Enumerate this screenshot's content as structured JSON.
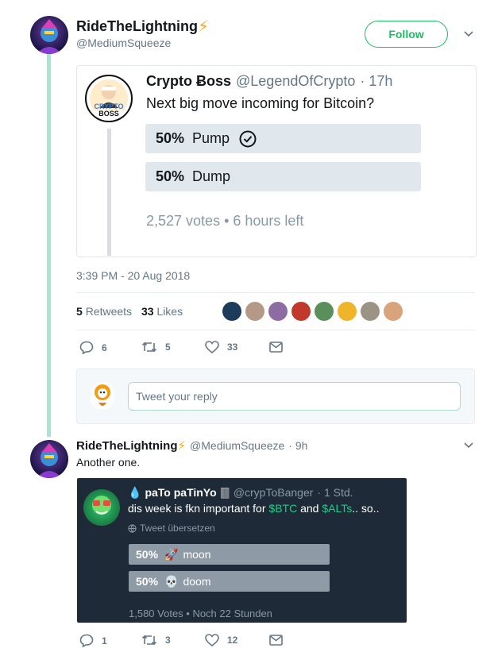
{
  "tweet": {
    "author_name": "RideTheLightning",
    "author_emoji": "⚡",
    "author_handle": "@MediumSqueeze",
    "follow_label": "Follow",
    "timestamp": "3:39 PM - 20 Aug 2018",
    "retweets_count": "5",
    "retweets_label": "Retweets",
    "likes_count": "33",
    "likes_label": "Likes",
    "actions": {
      "replies": "6",
      "retweets": "5",
      "likes": "33"
    },
    "reply_placeholder": "Tweet your reply"
  },
  "quoted": {
    "author_name": "Crypto Ƀoss",
    "author_handle": "@LegendOfCrypto",
    "time": "· 17h",
    "text": "Next big move incoming for Bitcoin?",
    "avatar_text_1": "CRYPTO",
    "avatar_text_2": "BOSS",
    "poll": [
      {
        "percent": "50%",
        "label": "Pump",
        "percent_value": 50,
        "selected": true
      },
      {
        "percent": "50%",
        "label": "Dump",
        "percent_value": 50,
        "selected": false
      }
    ],
    "summary": "2,527 votes • 6 hours left"
  },
  "reply": {
    "author_name": "RideTheLightning",
    "author_emoji": "⚡",
    "author_handle": "@MediumSqueeze",
    "time": "· 9h",
    "text": "Another one.",
    "actions": {
      "replies": "1",
      "retweets": "3",
      "likes": "12"
    }
  },
  "embedded": {
    "author_prefix": "💧",
    "author_name": "paTo paTinYo",
    "author_suffix": "🀫",
    "author_handle": "@crypToBanger",
    "time": "· 1 Std.",
    "text_part1": "dis week is fkn important for ",
    "text_btc": "$BTC",
    "text_and": " and ",
    "text_alts": "$ALTs",
    "text_end": ".. so..",
    "translate": "Tweet übersetzen",
    "poll": [
      {
        "percent": "50%",
        "emoji": "🚀",
        "label": "moon",
        "percent_value": 50
      },
      {
        "percent": "50%",
        "emoji": "💀",
        "label": "doom",
        "percent_value": 50
      }
    ],
    "summary": "1,580 Votes • Noch 22 Stunden"
  },
  "colors": {
    "accent": "#17bf63",
    "thread": "#a8e6d4",
    "dark_card": "#1e2a38"
  },
  "liker_avatar_count": 8
}
